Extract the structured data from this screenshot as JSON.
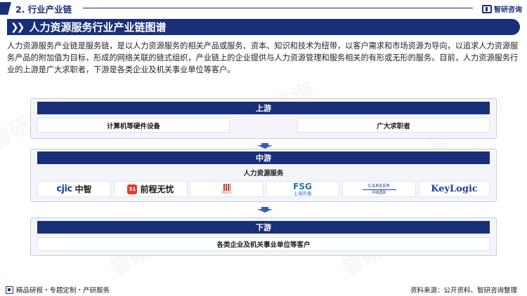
{
  "header": {
    "section": "2. 行业产业链",
    "brand": "智研咨询"
  },
  "title": "人力资源服务行业产业链图谱",
  "intro": "人力资源服务产业链是服务链，是以人力资源服务的相关产品或服务、资本、知识和技术为纽带，以客户需求和市场资源为导向，以追求人力资源服务产品的附加值为目标，形成的网络关联的链式组织，产业链上的企业提供与人力资源管理和服务相关的有形或无形的服务。目前，人力资源服务行业的上游是广大求职者，下游是各类企业及机关事业单位等客户。",
  "upstream": {
    "label": "上游",
    "items": [
      "计算机等硬件设备",
      "广大求职者"
    ]
  },
  "midstream": {
    "label": "中游",
    "sublabel": "人力资源服务",
    "companies": [
      {
        "name": "中智",
        "mark": "cjic",
        "color": "#1f3f9a"
      },
      {
        "name": "前程无忧",
        "mark": "51",
        "color": "#e63a2e"
      },
      {
        "name": "FESCO",
        "color": "#c0392b"
      },
      {
        "name": "FSG",
        "sub": "上海外服",
        "color": "#1f6fc1"
      },
      {
        "name": "CAREER",
        "sub": "科锐国际",
        "color": "#1f3f9a"
      },
      {
        "name": "KeyLogic",
        "color": "#1f3f9a"
      }
    ]
  },
  "downstream": {
    "label": "下游",
    "items": [
      "各类企业及机关事业单位等客户"
    ]
  },
  "footer": {
    "left": "精品研报・专题定制・产研服务",
    "right": "资料来源：公开资料、智研咨询整理"
  },
  "watermark": "智研咨询"
}
